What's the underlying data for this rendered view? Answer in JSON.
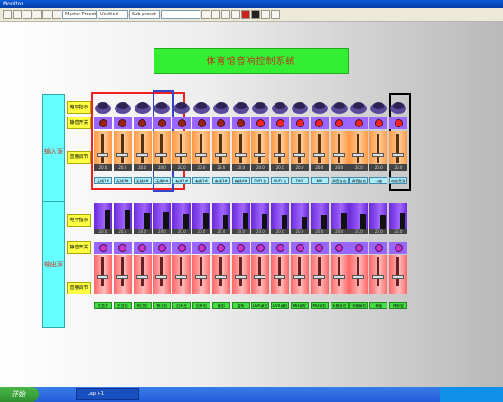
{
  "window": {
    "title": "Monitor"
  },
  "toolbar": {
    "combo1": "Master Preset",
    "combo2": "Untitled",
    "combo3": "Sub preset",
    "combo4": ""
  },
  "banner": {
    "title": "体育馆音响控制系统"
  },
  "input": {
    "section_label": "输入源",
    "rows": {
      "level": "电平指示",
      "mute": "静音开关",
      "volume": "音量调节"
    },
    "channels": [
      {
        "name": "无线1#",
        "value": "20.0",
        "mute": "off"
      },
      {
        "name": "无线2#",
        "value": "20.0",
        "mute": "off"
      },
      {
        "name": "无线3#",
        "value": "20.0",
        "mute": "off"
      },
      {
        "name": "无线4#",
        "value": "20.0",
        "mute": "off"
      },
      {
        "name": "有线1#",
        "value": "20.0",
        "mute": "off"
      },
      {
        "name": "有线2#",
        "value": "20.0",
        "mute": "off"
      },
      {
        "name": "有线3#",
        "value": "20.0",
        "mute": "off"
      },
      {
        "name": "有线4#",
        "value": "20.0",
        "mute": "off"
      },
      {
        "name": "DVD 左",
        "value": "20.0",
        "mute": "on"
      },
      {
        "name": "DVD 右",
        "value": "20.0",
        "mute": "on"
      },
      {
        "name": "DVR",
        "value": "20.0",
        "mute": "on"
      },
      {
        "name": "MD",
        "value": "20.0",
        "mute": "on"
      },
      {
        "name": "调音台左",
        "value": "20.0",
        "mute": "on"
      },
      {
        "name": "调音台右",
        "value": "20.0",
        "mute": "on"
      },
      {
        "name": "卡座",
        "value": "20.0",
        "mute": "on"
      },
      {
        "name": "电脑音源",
        "value": "20.0",
        "mute": "on"
      }
    ]
  },
  "output": {
    "section_label": "输出源",
    "rows": {
      "level": "电平指示",
      "mute": "静音开关",
      "volume": "音量调节"
    },
    "channels": [
      {
        "name": "主音左",
        "value": "20.0",
        "level": 0.85
      },
      {
        "name": "主音右",
        "value": "20.0",
        "level": 0.8
      },
      {
        "name": "侧江左",
        "value": "20.0",
        "level": 0.7
      },
      {
        "name": "侧江右",
        "value": "20.0",
        "level": 0.75
      },
      {
        "name": "后补左",
        "value": "20.0",
        "level": 0.65
      },
      {
        "name": "后补右",
        "value": "20.0",
        "level": 0.7
      },
      {
        "name": "备用",
        "value": "20.0",
        "level": 0.6
      },
      {
        "name": "监听",
        "value": "20.0",
        "level": 0.7
      },
      {
        "name": "DVR录左",
        "value": "20.0",
        "level": 0.65
      },
      {
        "name": "DVR录右",
        "value": "20.0",
        "level": 0.6
      },
      {
        "name": "MD录左",
        "value": "20.0",
        "level": 0.55
      },
      {
        "name": "MD录右",
        "value": "20.0",
        "level": 0.6
      },
      {
        "name": "卡座录左",
        "value": "20.0",
        "level": 0.7
      },
      {
        "name": "卡座录右",
        "value": "20.0",
        "level": 0.65
      },
      {
        "name": "预留",
        "value": "20.0",
        "level": 0.6
      },
      {
        "name": "休息室",
        "value": "20.0",
        "level": 0.7
      }
    ]
  },
  "taskbar": {
    "start": "开始",
    "task": "Lap +1",
    "tray": ""
  },
  "colors": {
    "banner": "#33ee33",
    "section": "#66ffff",
    "row_label": "#ffff44",
    "input_fader": "#ff9944",
    "output_fader": "#ff6666",
    "mute_on": "#ff2222",
    "mute_off": "#992211"
  }
}
